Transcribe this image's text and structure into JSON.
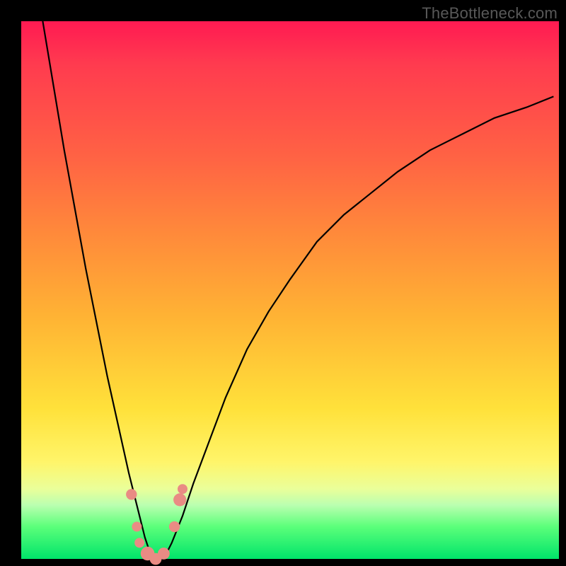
{
  "watermark": "TheBottleneck.com",
  "chart_data": {
    "type": "line",
    "title": "",
    "xlabel": "",
    "ylabel": "",
    "xlim": [
      0,
      100
    ],
    "ylim": [
      0,
      100
    ],
    "series": [
      {
        "name": "bottleneck-curve",
        "x": [
          4,
          6,
          8,
          10,
          12,
          14,
          16,
          18,
          20,
          21,
          22,
          23,
          24,
          25,
          26,
          27,
          28,
          30,
          32,
          35,
          38,
          42,
          46,
          50,
          55,
          60,
          65,
          70,
          76,
          82,
          88,
          94,
          99
        ],
        "y": [
          100,
          88,
          76,
          65,
          54,
          44,
          34,
          25,
          16,
          12,
          8,
          4,
          1,
          0,
          0,
          1,
          3,
          8,
          14,
          22,
          30,
          39,
          46,
          52,
          59,
          64,
          68,
          72,
          76,
          79,
          82,
          84,
          86
        ]
      }
    ],
    "markers": [
      {
        "x": 20.5,
        "y": 12,
        "r": 1.1
      },
      {
        "x": 21.5,
        "y": 6,
        "r": 1.0
      },
      {
        "x": 22.0,
        "y": 3,
        "r": 1.0
      },
      {
        "x": 23.5,
        "y": 1,
        "r": 1.4
      },
      {
        "x": 25.0,
        "y": 0,
        "r": 1.2
      },
      {
        "x": 26.5,
        "y": 1,
        "r": 1.2
      },
      {
        "x": 28.5,
        "y": 6,
        "r": 1.1
      },
      {
        "x": 29.5,
        "y": 11,
        "r": 1.3
      },
      {
        "x": 30.0,
        "y": 13,
        "r": 1.0
      }
    ],
    "marker_color": "#e98b84",
    "curve_color": "#000000"
  }
}
